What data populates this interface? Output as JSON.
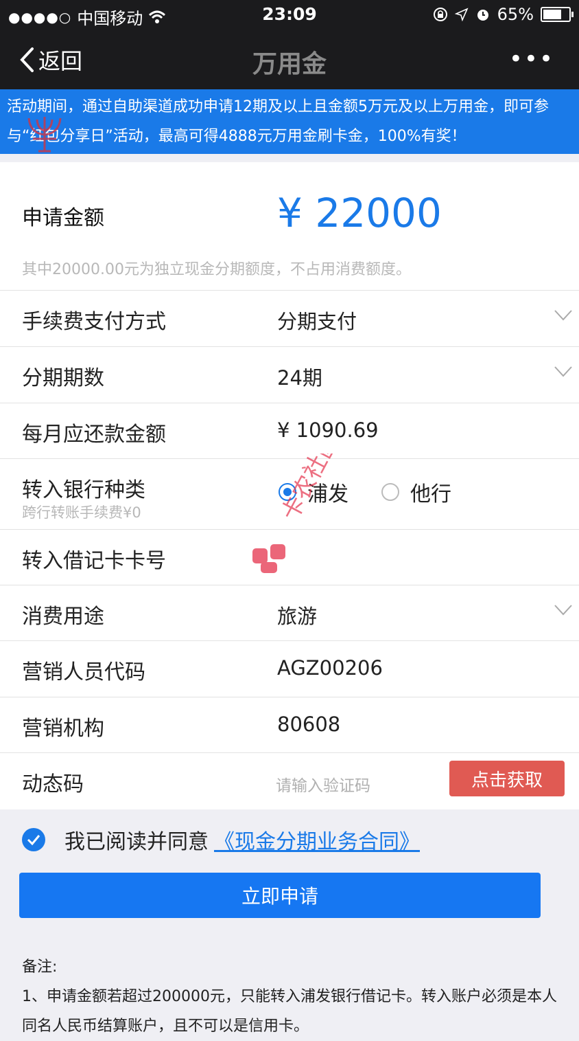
{
  "status_bar": {
    "signal": "●●●●○",
    "carrier": "中国移动",
    "time": "23:09",
    "battery": "65%"
  },
  "nav": {
    "back_label": "返回",
    "title": "万用金",
    "more_label": "•••"
  },
  "banner": {
    "text": "活动期间，通过自助渠道成功申请12期及以上且金额5万元及以上万用金，即可参与“红包分享日”活动，最高可得4888元万用金刷卡金，100%有奖！"
  },
  "form": {
    "amount_label": "申请金额",
    "amount_value": "¥ 22000",
    "amount_note": "其中20000.00元为独立现金分期额度，不占用消费额度。",
    "fee_label": "手续费支付方式",
    "fee_value": "分期支付",
    "period_label": "分期期数",
    "period_value": "24期",
    "monthly_label": "每月应还款金额",
    "monthly_value": "¥  1090.69",
    "bank_label": "转入银行种类",
    "bank_sub": "跨行转账手续费¥0",
    "bank_options": [
      "浦发",
      "他行"
    ],
    "card_label": "转入借记卡卡号",
    "purpose_label": "消费用途",
    "purpose_value": "旅游",
    "staff_label": "营销人员代码",
    "staff_value": "AGZ00206",
    "org_label": "营销机构",
    "org_value": "80608",
    "code_label": "动态码",
    "code_placeholder": "请输入验证码",
    "code_button": "点击获取"
  },
  "agreement": {
    "text": "我已阅读并同意",
    "link": "《现金分期业务合同》"
  },
  "submit_label": "立即申请",
  "notes": {
    "title": "备注:",
    "line1": "1、申请金额若超过200000元，只能转入浦发银行借记卡。转入账户必须是本人同名人民币结算账户，且不可以是信用卡。"
  },
  "colors": {
    "accent": "#1a7ae8",
    "danger": "#e05a53",
    "header_bg": "#1b1b1d"
  },
  "watermark": "卡农社区"
}
